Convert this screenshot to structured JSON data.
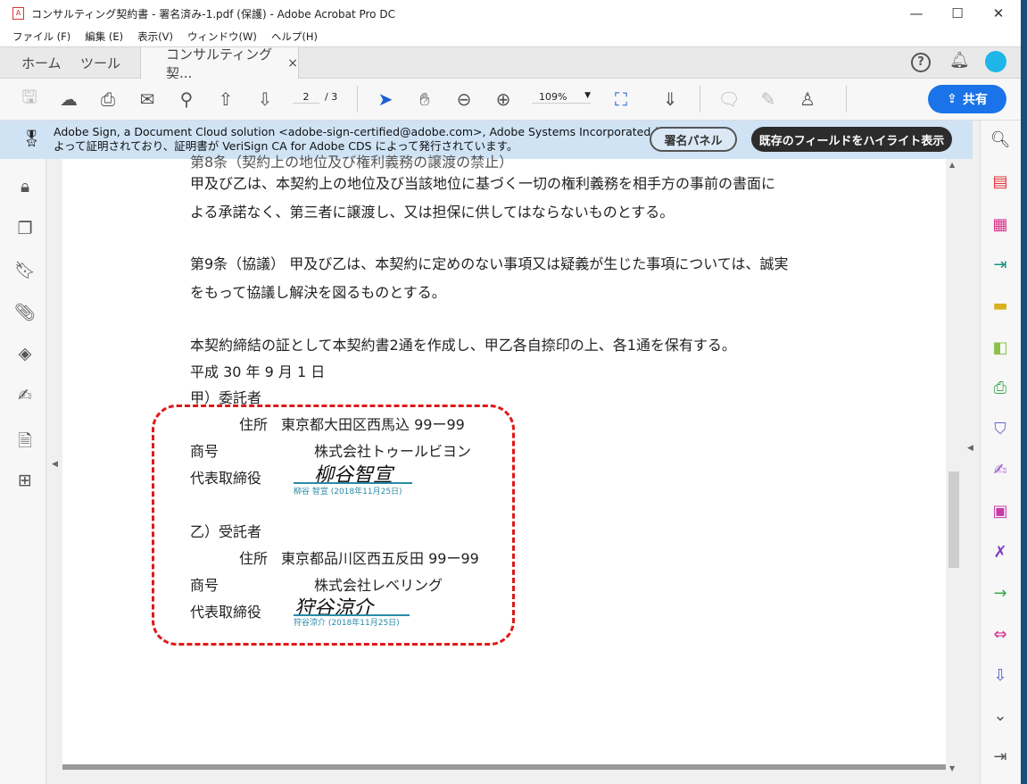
{
  "window": {
    "title": "コンサルティング契約書 - 署名済み-1.pdf (保護) - Adobe Acrobat Pro DC",
    "minimize": "—",
    "maximize": "☐",
    "close": "✕"
  },
  "menu": [
    "ファイル (F)",
    "編集 (E)",
    "表示(V)",
    "ウィンドウ(W)",
    "ヘルプ(H)"
  ],
  "tabs": {
    "home": "ホーム",
    "tools": "ツール",
    "doc": "コンサルティング契...",
    "close": "×"
  },
  "toolbar": {
    "page_current": "2",
    "page_total": "/ 3",
    "zoom": "109%",
    "share": "共有"
  },
  "banner": {
    "line1": "Adobe Sign, a Document Cloud solution <adobe-sign-certified@adobe.com>, Adobe Systems Incorporated に",
    "line2": "よって証明されており、証明書が VeriSign CA for Adobe CDS によって発行されています。",
    "sign_panel": "署名パネル",
    "highlight_fields": "既存のフィールドをハイライト表示"
  },
  "document": {
    "clipped": "第8条（契約上の地位及び権利義務の譲渡の禁止）",
    "p1a": "甲及び乙は、本契約上の地位及び当該地位に基づく一切の権利義務を相手方の事前の書面に",
    "p1b": "よる承諾なく、第三者に譲渡し、又は担保に供してはならないものとする。",
    "p2a": "第9条（協議）  甲及び乙は、本契約に定めのない事項又は疑義が生じた事項については、誠実",
    "p2b": "をもって協議し解決を図るものとする。",
    "p3": "本契約締結の証として本契約書2通を作成し、甲乙各自捺印の上、各1通を保有する。",
    "date": "平成  30 年 9 月 1 日",
    "party_a": {
      "role": "甲）委託者",
      "address_label": "住所",
      "address": "東京都大田区西馬込 99ー99",
      "company_label": "商号",
      "company": "株式会社トゥールビヨン",
      "rep_label": "代表取締役",
      "signature": "柳谷智宣",
      "sig_caption": "柳谷 智宣 (2018年11月25日)"
    },
    "party_b": {
      "role": "乙）受託者",
      "address_label": "住所",
      "address": "東京都品川区西五反田 99ー99",
      "company_label": "商号",
      "company": "株式会社レベリング",
      "rep_label": "代表取締役",
      "signature": "狩谷涼介",
      "sig_caption": "狩谷涼介 (2018年11月25日)"
    }
  },
  "colors": {
    "accent": "#1a73e8",
    "banner": "#cfe3f5",
    "annotation": "#e01818",
    "signature_line": "#2a8aa6"
  }
}
